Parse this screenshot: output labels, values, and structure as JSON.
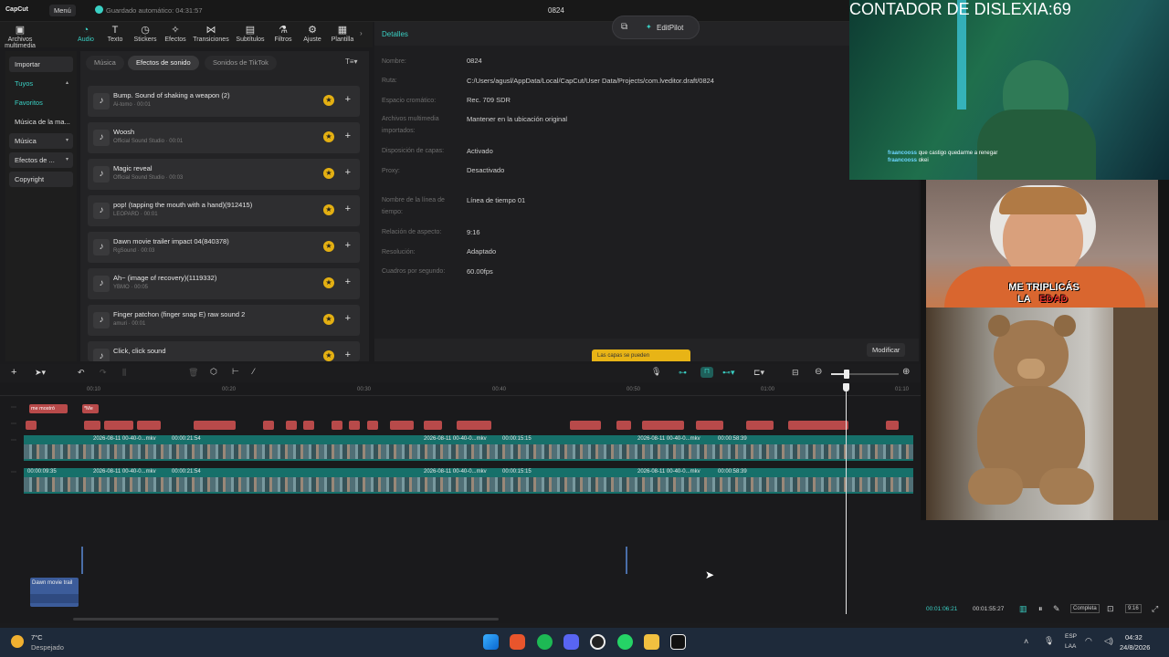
{
  "titlebar": {
    "app": "CapCut",
    "menu": "Menú",
    "autosave": "Guardado automático: 04:31:57",
    "project": "0824"
  },
  "toolbar": {
    "items": [
      {
        "label": "Archivos multimedia",
        "icon": "media-icon"
      },
      {
        "label": "Audio",
        "icon": "audio-icon"
      },
      {
        "label": "Texto",
        "icon": "text-icon"
      },
      {
        "label": "Stickers",
        "icon": "sticker-icon"
      },
      {
        "label": "Efectos",
        "icon": "effects-icon"
      },
      {
        "label": "Transiciones",
        "icon": "transition-icon"
      },
      {
        "label": "Subtítulos",
        "icon": "captions-icon"
      },
      {
        "label": "Filtros",
        "icon": "filter-icon"
      },
      {
        "label": "Ajuste",
        "icon": "adjust-icon"
      },
      {
        "label": "Plantilla",
        "icon": "template-icon"
      }
    ]
  },
  "leftnav": {
    "items": [
      "Importar",
      "Tuyos",
      "Favoritos",
      "Música de la ma...",
      "Música",
      "Efectos de ...",
      "Copyright"
    ]
  },
  "library": {
    "tabs": [
      "Música",
      "Efectos de sonido",
      "Sonidos de TikTok"
    ],
    "sounds": [
      {
        "title": "Bump. Sound of shaking a weapon (2)",
        "sub": "Ai-tomo · 00:01"
      },
      {
        "title": "Woosh",
        "sub": "Official Sound Studio · 00:01"
      },
      {
        "title": "Magic reveal",
        "sub": "Official Sound Studio · 00:03"
      },
      {
        "title": "pop! (tapping the mouth with a hand)(912415)",
        "sub": "LEOPARD · 00:01"
      },
      {
        "title": "Dawn movie trailer impact 04(840378)",
        "sub": "RgSound · 00:03"
      },
      {
        "title": "Ah~ (image of recovery)(1119332)",
        "sub": "YBMO · 00:05"
      },
      {
        "title": "Finger patchon (finger snap E) raw sound 2",
        "sub": "amuri · 00:01"
      },
      {
        "title": "Click, click sound",
        "sub": ""
      }
    ]
  },
  "details": {
    "header": "Detalles",
    "rows": [
      {
        "label": "Nombre:",
        "value": "0824"
      },
      {
        "label": "Ruta:",
        "value": "C:/Users/agusl/AppData/Local/CapCut/User Data/Projects/com.lveditor.draft/0824"
      },
      {
        "label": "Espacio cromático:",
        "value": "Rec. 709 SDR"
      },
      {
        "label": "Archivos multimedia importados:",
        "value": "Mantener en la ubicación original"
      },
      {
        "label": "Disposición de capas:",
        "value": "Activado"
      },
      {
        "label": "Proxy:",
        "value": "Desactivado"
      },
      {
        "label": "Nombre de la línea de tiempo:",
        "value": "Línea de tiempo 01"
      },
      {
        "label": "Relación de aspecto:",
        "value": "9:16"
      },
      {
        "label": "Resolución:",
        "value": "Adaptado"
      },
      {
        "label": "Cuadros por segundo:",
        "value": "60.00fps"
      }
    ],
    "modify": "Modificar",
    "tooltip": "Las capas se pueden"
  },
  "editpilot": {
    "label": "EditPilot"
  },
  "timeline": {
    "ticks": [
      "00:10",
      "00:20",
      "00:30",
      "00:40",
      "00:50",
      "01:00",
      "01:10"
    ],
    "labels_top": [
      "me mostró",
      "*Me"
    ],
    "clips": [
      {
        "a": "2026-08-11 00-40-0...mkv",
        "b": "00:00:21:54"
      },
      {
        "a": "2026-08-11 00-40-0...mkv",
        "b": "00:00:15:15"
      },
      {
        "a": "2026-08-11 00-40-0...mkv",
        "b": "00:00:58:39"
      }
    ],
    "first_clip_time": "00:00:09:35",
    "audio_clip": "Dawn movie trail",
    "current_time": "00:01:06:21",
    "total_time": "00:01:55:27",
    "full": "Completa",
    "ratio": "9:16"
  },
  "stream": {
    "counter": "CONTADOR DE DISLEXIA:69",
    "chat": [
      {
        "user": "fraancooss",
        "msg": "que castigo quedarme a renegar"
      },
      {
        "user": "fraancooss",
        "msg": "okei"
      }
    ],
    "caption_line1": "ME TRIPLICÁS",
    "caption_line2a": "LA",
    "caption_line2b": "EDAD"
  },
  "taskbar": {
    "temp": "7°C",
    "weather": "Despejado",
    "lang": "ESP",
    "lang2": "LAA",
    "time": "04:32",
    "date": "24/8/2026"
  },
  "colors": {
    "accent": "#3ad0c4",
    "text_clip": "#b84a4a",
    "video_clip": "#16706a",
    "star": "#e4b012"
  }
}
